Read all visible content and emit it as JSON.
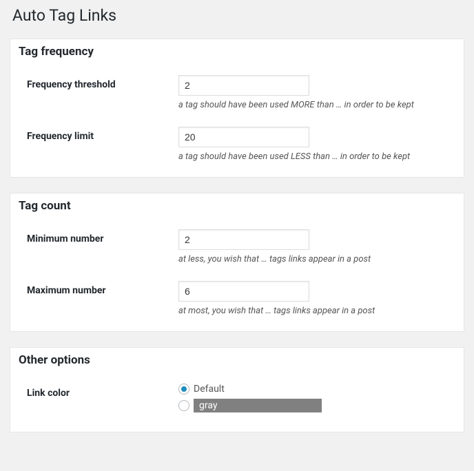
{
  "page_title": "Auto Tag Links",
  "sections": {
    "tag_frequency": {
      "heading": "Tag frequency",
      "threshold": {
        "label": "Frequency threshold",
        "value": "2",
        "desc": "a tag should have been used MORE than … in order to be kept"
      },
      "limit": {
        "label": "Frequency limit",
        "value": "20",
        "desc": "a tag should have been used LESS than … in order to be kept"
      }
    },
    "tag_count": {
      "heading": "Tag count",
      "minimum": {
        "label": "Minimum number",
        "value": "2",
        "desc": "at less, you wish that … tags links appear in a post"
      },
      "maximum": {
        "label": "Maximum number",
        "value": "6",
        "desc": "at most, you wish that … tags links appear in a post"
      }
    },
    "other_options": {
      "heading": "Other options",
      "link_color": {
        "label": "Link color",
        "options": {
          "default": "Default",
          "custom_value": "gray"
        },
        "selected": "default"
      }
    }
  },
  "colors": {
    "accent": "#1e8cbe",
    "chip_bg": "#808080"
  }
}
